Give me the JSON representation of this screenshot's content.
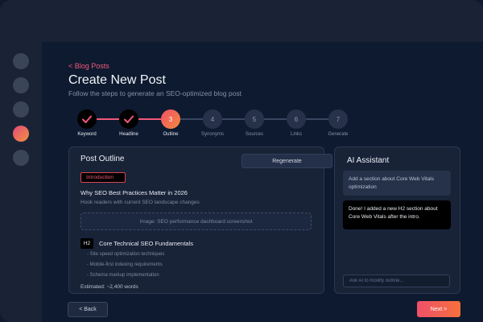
{
  "header": {
    "back_link": "< Blog Posts",
    "title": "Create New Post",
    "subtitle": "Follow the steps to generate an SEO-optimized blog post"
  },
  "stepper": {
    "steps": [
      {
        "number": "",
        "label": "Keyword",
        "state": "done"
      },
      {
        "number": "",
        "label": "Headline",
        "state": "done"
      },
      {
        "number": "3",
        "label": "Outline",
        "state": "current"
      },
      {
        "number": "4",
        "label": "Synonyms",
        "state": "upcoming"
      },
      {
        "number": "5",
        "label": "Sources",
        "state": "upcoming"
      },
      {
        "number": "6",
        "label": "Links",
        "state": "upcoming"
      },
      {
        "number": "7",
        "label": "Generate",
        "state": "upcoming"
      }
    ]
  },
  "outline": {
    "title": "Post Outline",
    "regenerate_label": "Regenerate",
    "intro_tag": "Introduction",
    "intro_heading": "Why SEO Best Practices Matter in 2026",
    "intro_subtext": "Hook readers with current SEO landscape changes",
    "image_placeholder": "Image: SEO performance dashboard screenshot",
    "h2_badge": "H2",
    "h2_heading": "Core Technical SEO Fundamentals",
    "bullets": [
      "- Site speed optimization techniques",
      "- Mobile-first indexing requirements",
      "- Schema markup implementation"
    ],
    "estimate": "Estimated: ~2,400 words"
  },
  "assistant": {
    "title": "AI Assistant",
    "user_message": "Add a section about Core Web Vitals optimization",
    "bot_message": "Done! I added a new H2 section about Core Web Vitals after the intro.",
    "input_placeholder": "Ask AI to modify outline..."
  },
  "footer": {
    "back_label": "< Back",
    "next_label": "Next >"
  },
  "colors": {
    "accent": "#f2587b",
    "accent_gradient_end": "#f58a3c",
    "background": "#0e1a30",
    "card": "#182338"
  }
}
